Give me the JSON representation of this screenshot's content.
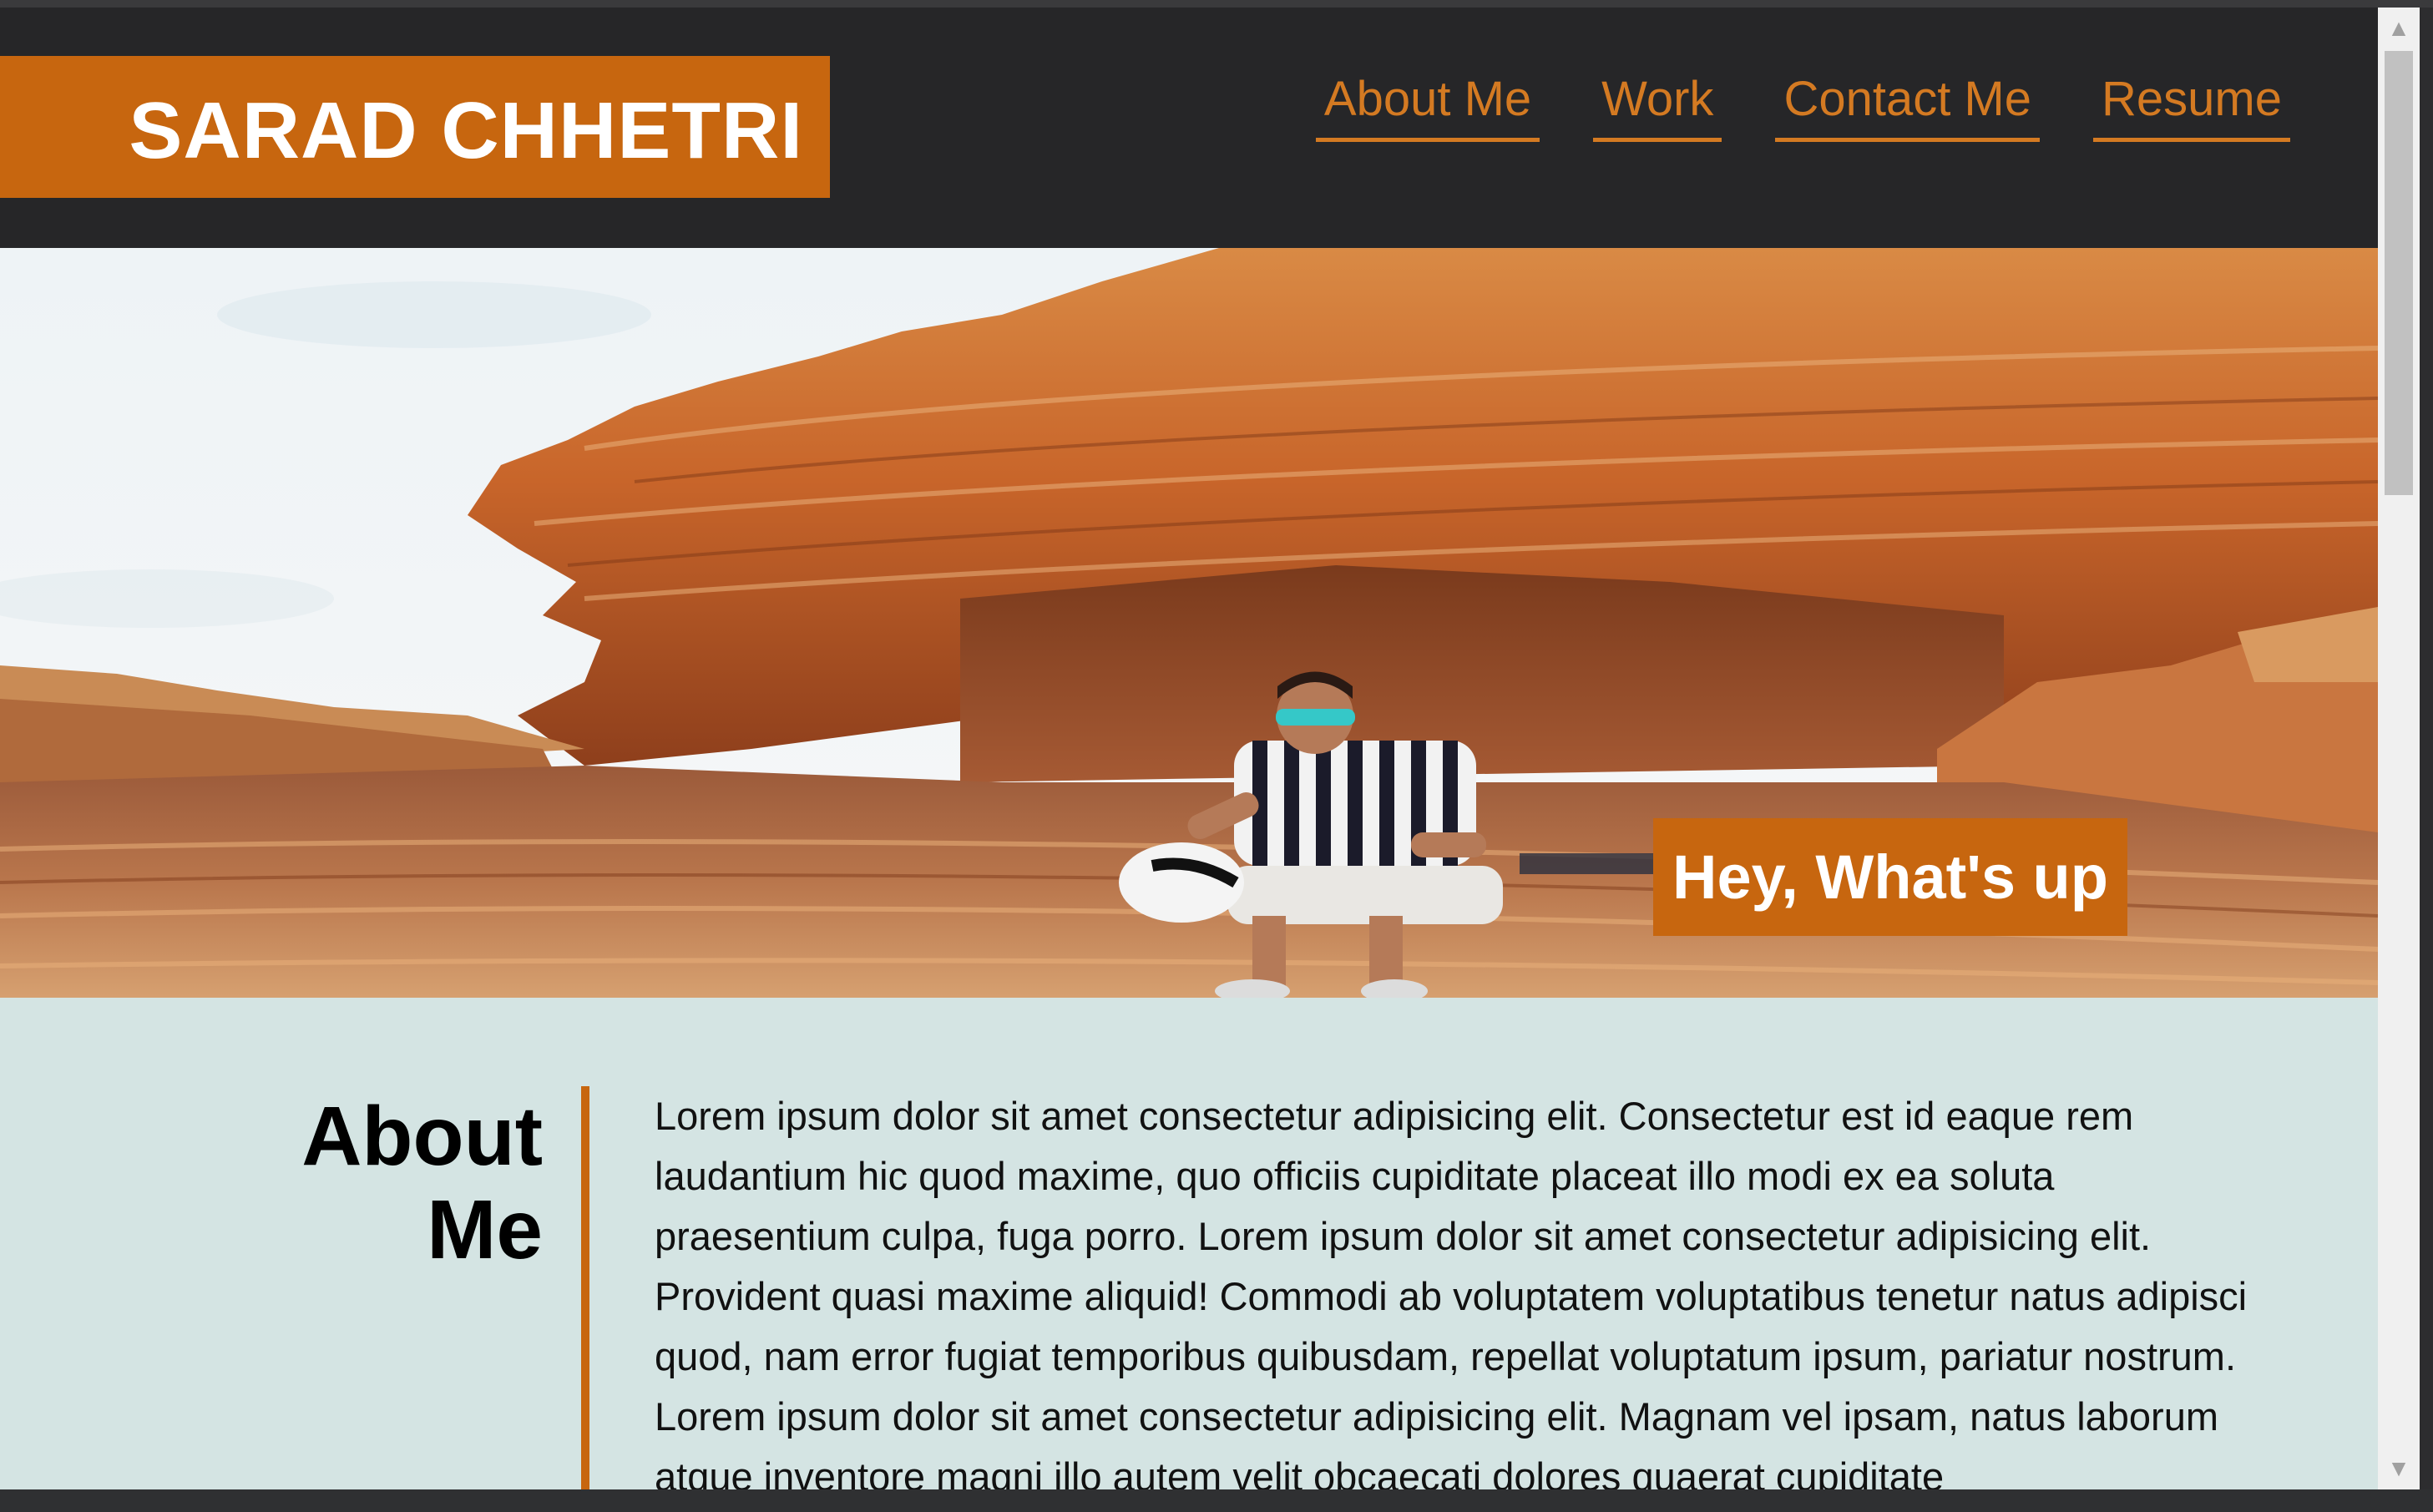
{
  "colors": {
    "brand_accent": "#c7660f",
    "header_bg": "#262628",
    "nav_link": "#d47a22",
    "about_bg": "#d4e4e3",
    "text_light": "#ffffff",
    "text_dark": "#000000"
  },
  "header": {
    "brand": "SARAD CHHETRI",
    "nav": [
      {
        "label": "About Me"
      },
      {
        "label": "Work"
      },
      {
        "label": "Contact Me"
      },
      {
        "label": "Resume"
      }
    ]
  },
  "hero": {
    "tagline": "Hey, What's up",
    "image_subject": "person-seated-under-sandstone-rock-overhang"
  },
  "about": {
    "heading_line1": "About",
    "heading_line2": "Me",
    "body": "Lorem ipsum dolor sit amet consectetur adipisicing elit. Consectetur est id eaque rem laudantium hic quod maxime, quo officiis cupiditate placeat illo modi ex ea soluta praesentium culpa, fuga porro. Lorem ipsum dolor sit amet consectetur adipisicing elit. Provident quasi maxime aliquid! Commodi ab voluptatem voluptatibus tenetur natus adipisci quod, nam error fugiat temporibus quibusdam, repellat voluptatum ipsum, pariatur nostrum. Lorem ipsum dolor sit amet consectetur adipisicing elit. Magnam vel ipsam, natus laborum atque inventore magni illo autem velit obcaecati dolores quaerat cupiditate"
  },
  "scrollbar": {
    "up_icon": "triangle-up-icon",
    "down_icon": "triangle-down-icon"
  }
}
